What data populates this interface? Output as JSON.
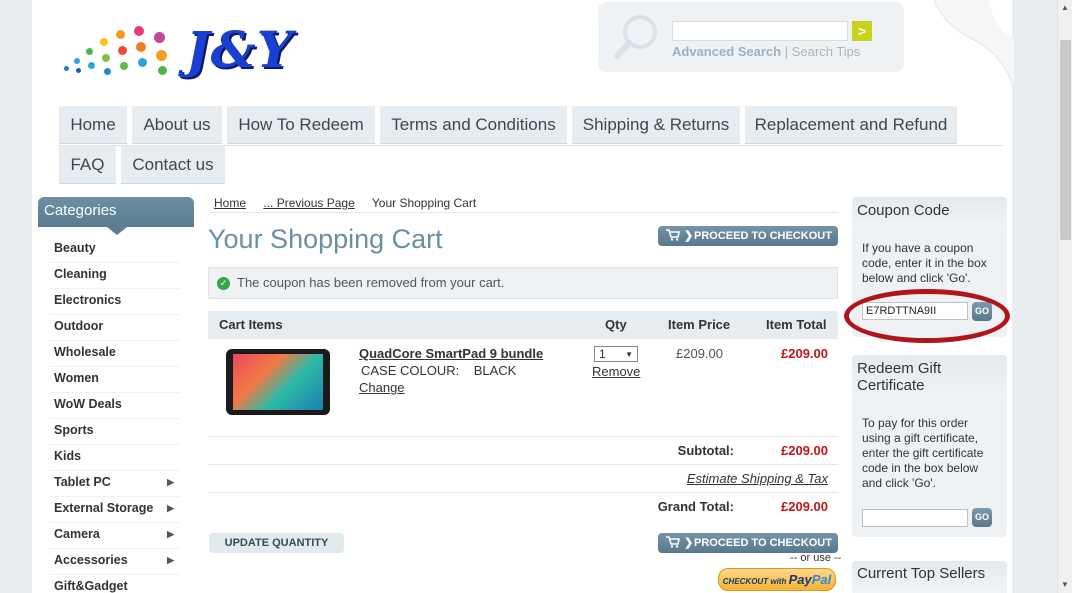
{
  "brand": {
    "logo_text": "J&Y"
  },
  "search": {
    "go_label": ">",
    "advanced_label": "Advanced Search",
    "separator": "|",
    "tips_label": "Search Tips"
  },
  "nav": {
    "items": [
      "Home",
      "About us",
      "How To Redeem",
      "Terms and Conditions",
      "Shipping & Returns",
      "Replacement and Refund",
      "FAQ",
      "Contact us"
    ]
  },
  "categories": {
    "title": "Categories",
    "items": [
      "Beauty",
      "Cleaning",
      "Electronics",
      "Outdoor",
      "Wholesale",
      "Women",
      "WoW Deals",
      "Sports",
      "Kids",
      "Tablet PC",
      "External Storage",
      "Camera",
      "Accessories",
      "Gift&Gadget"
    ]
  },
  "breadcrumb": {
    "home": "Home",
    "previous": "... Previous Page",
    "current": "Your Shopping Cart"
  },
  "cart": {
    "title": "Your Shopping Cart",
    "checkout_label": "PROCEED TO CHECKOUT",
    "message": "The coupon has been removed from your cart.",
    "headers": {
      "items": "Cart Items",
      "qty": "Qty",
      "price": "Item Price",
      "total": "Item Total"
    },
    "item": {
      "name": "QuadCore SmartPad 9 bundle",
      "option_label": "CASE COLOUR:",
      "option_value": "BLACK",
      "change_label": "Change",
      "qty": "1",
      "remove_label": "Remove",
      "price": "£209.00",
      "total": "£209.00"
    },
    "subtotal_label": "Subtotal:",
    "subtotal": "£209.00",
    "estimate_label": "Estimate Shipping & Tax",
    "grand_total_label": "Grand Total:",
    "grand_total": "£209.00",
    "update_label": "UPDATE QUANTITY",
    "or_use": "-- or use --",
    "paypal_prefix": "CHECKOUT",
    "paypal_with": "with",
    "paypal_pay": "Pay",
    "paypal_pal": "Pal"
  },
  "coupon": {
    "title": "Coupon Code",
    "text": "If you have a coupon code, enter it in the box below and click 'Go'.",
    "value": "E7RDTTNA9II",
    "go_label": "GO"
  },
  "gift": {
    "title": "Redeem Gift Certificate",
    "text": "To pay for this order using a gift certificate, enter the gift certificate code in the box below and click 'Go'.",
    "go_label": "GO"
  },
  "top_sellers": {
    "title": "Current Top Sellers"
  },
  "colors": {
    "accent": "#6b8fa4",
    "price_red": "#c0161a",
    "highlight_ellipse": "#b2141b"
  }
}
